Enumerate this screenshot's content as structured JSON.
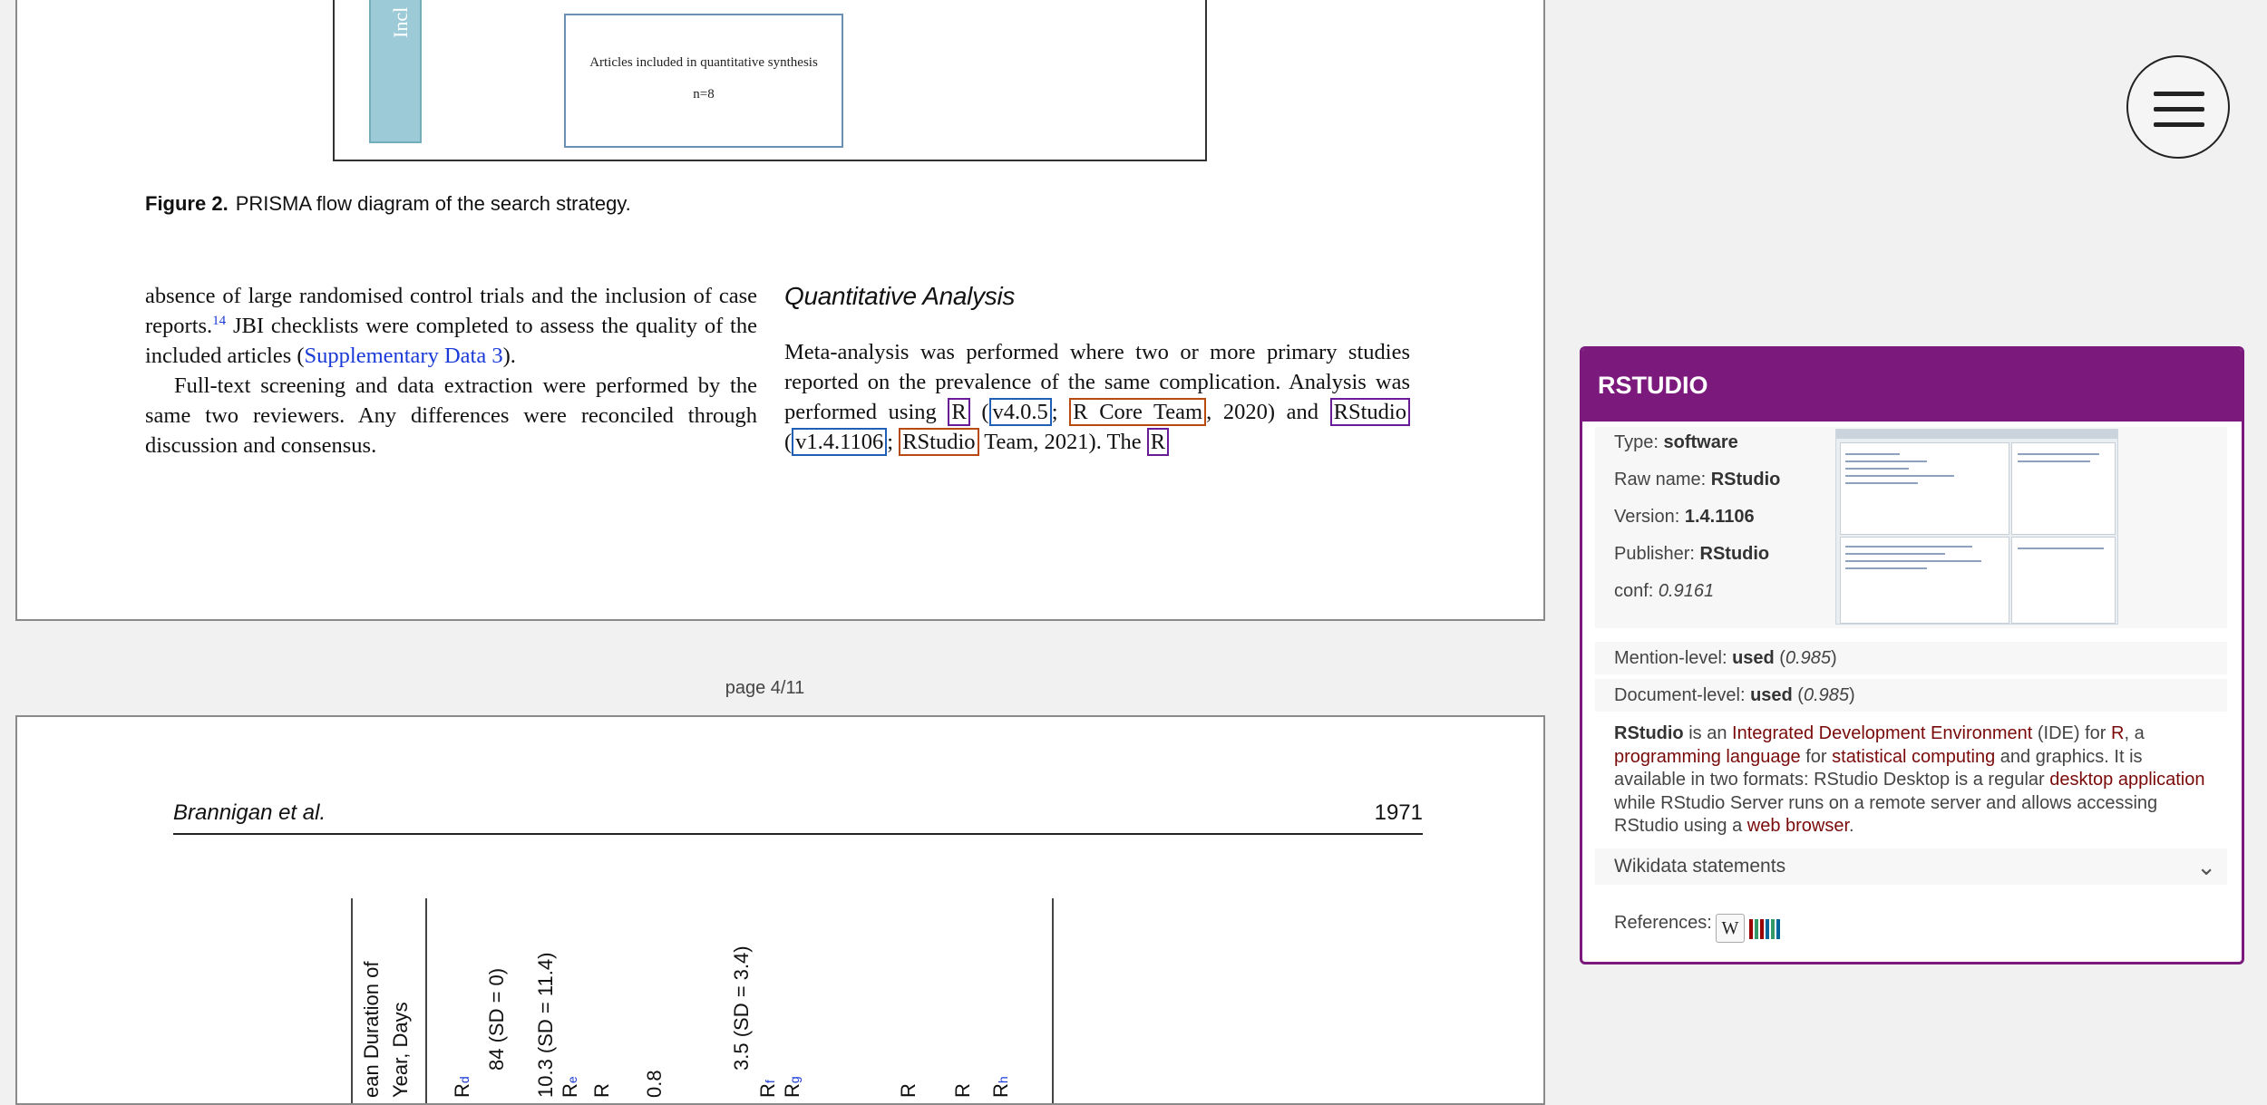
{
  "document": {
    "flow_side_label": "Incl",
    "flow_box_line1": "Articles included in quantitative synthesis",
    "flow_box_line2": "n=8",
    "figure_label": "Figure 2.",
    "figure_caption": "PRISMA flow diagram of the search strategy.",
    "left_col": {
      "p1_a": "absence of large randomised control trials and the inclusion of case reports.",
      "p1_sup": "14",
      "p1_b": " JBI checklists were completed to assess the quality of the included articles (",
      "p1_link": "Supplementary Data 3",
      "p1_c": ").",
      "p2": "Full-text screening and data extraction were performed by the same two reviewers. Any differences were reconciled through discussion and consensus."
    },
    "right_col": {
      "title": "Quantitative Analysis",
      "t1": "Meta-analysis was performed where two or more primary studies reported on the prevalence of the same complication. Analysis was performed using ",
      "m_r": "R",
      "t2": " (",
      "m_v1": "v4.0.5",
      "t3": "; ",
      "m_rcore": "R Core Team",
      "t4": ", 2020) and ",
      "m_rstudio": "RStudio",
      "t5": " (",
      "m_v2": "v1.4.1106",
      "t6": "; ",
      "m_rstudio2": "RStudio",
      "t7": " Team, 2021). The ",
      "m_r2": "R"
    },
    "page_indicator": "page 4/11",
    "running_head_author": "Brannigan et al.",
    "running_head_page": "1971",
    "table_headers": [
      {
        "text": "ean Duration of"
      },
      {
        "text": "Year, Days"
      },
      {
        "text": "R",
        "sup": "d"
      },
      {
        "text": "84 (SD = 0)"
      },
      {
        "text": "10.3 (SD = 11.4)"
      },
      {
        "text": "R",
        "sup": "e"
      },
      {
        "text": "R"
      },
      {
        "text": "0.8"
      },
      {
        "text": "3.5 (SD = 3.4)"
      },
      {
        "text": "R",
        "sup": "f"
      },
      {
        "text": "R",
        "sup": "g"
      },
      {
        "text": "R"
      },
      {
        "text": "R"
      },
      {
        "text": "R",
        "sup": "h"
      }
    ]
  },
  "menu_icon": "hamburger-menu-icon",
  "panel": {
    "title": "RSTUDIO",
    "type_label": "Type: ",
    "type_value": "software",
    "raw_label": "Raw name: ",
    "raw_value": "RStudio",
    "version_label": "Version: ",
    "version_value": "1.4.1106",
    "publisher_label": "Publisher: ",
    "publisher_value": "RStudio",
    "conf_label": "conf: ",
    "conf_value": "0.9161",
    "mention_label": "Mention-level: ",
    "mention_value": "used",
    "mention_score": "0.985",
    "document_label": "Document-level: ",
    "document_value": "used",
    "document_score": "0.985",
    "desc": {
      "name": "RStudio",
      "t1": " is an ",
      "l1": "Integrated Development Environment",
      "t2": " (IDE) for ",
      "l2": "R",
      "t3": ", a ",
      "l3": "programming language",
      "t4": " for ",
      "l4": "statistical computing",
      "t5": " and graphics. It is available in two formats: RStudio Desktop is a regular ",
      "l5": "desktop application",
      "t6": " while RStudio Server runs on a remote server and allows accessing RStudio using a ",
      "l6": "web browser",
      "t7": "."
    },
    "wikidata_label": "Wikidata statements",
    "references_label": "References:",
    "ref_wiki_glyph": "W",
    "colors": {
      "accent": "#7b1a7c",
      "link": "#7a0a0a"
    }
  }
}
